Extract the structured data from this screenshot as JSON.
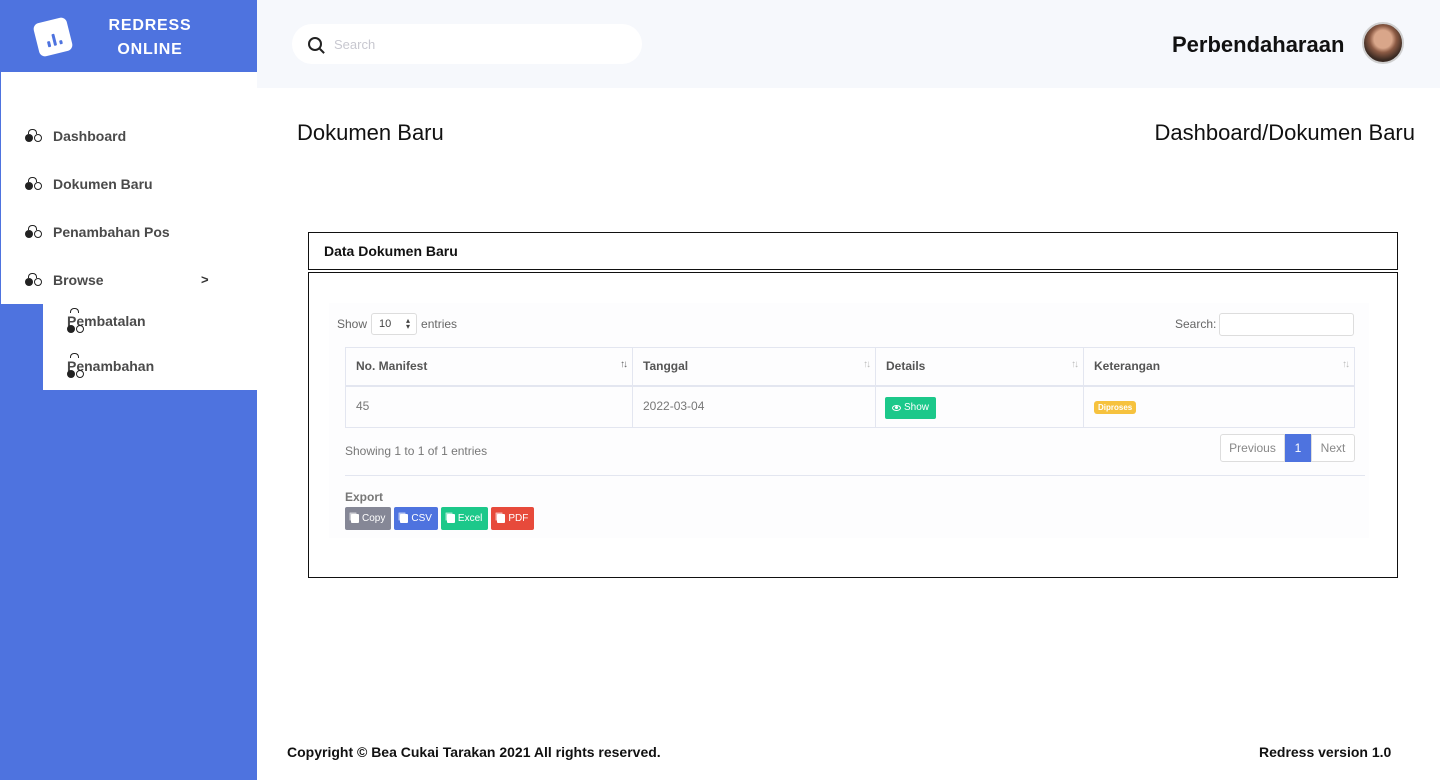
{
  "brand": {
    "line1": "REDRESS",
    "line2": "ONLINE"
  },
  "search": {
    "placeholder": "Search"
  },
  "user": {
    "name": "Perbendaharaan"
  },
  "sidebar": {
    "items": [
      {
        "label": "Dashboard"
      },
      {
        "label": "Dokumen Baru"
      },
      {
        "label": "Penambahan Pos"
      },
      {
        "label": "Browse",
        "chevron": ">"
      }
    ],
    "subitems": [
      {
        "label": "Pembatalan"
      },
      {
        "label": "Penambahan"
      }
    ]
  },
  "page": {
    "title": "Dokumen Baru",
    "breadcrumb": "Dashboard/Dokumen Baru"
  },
  "card": {
    "header": "Data Dokumen Baru"
  },
  "table_controls": {
    "show_label": "Show",
    "entries_value": "10",
    "entries_label": "entries",
    "search_label": "Search:"
  },
  "table": {
    "columns": [
      "No. Manifest",
      "Tanggal",
      "Details",
      "Keterangan"
    ],
    "rows": [
      {
        "manifest": "45",
        "tanggal": "2022-03-04",
        "details_btn": "Show",
        "keterangan": "Diproses"
      }
    ]
  },
  "pagination": {
    "info": "Showing 1 to 1 of 1 entries",
    "previous": "Previous",
    "current": "1",
    "next": "Next"
  },
  "export": {
    "label": "Export",
    "buttons": [
      {
        "label": "Copy",
        "color": "#858796"
      },
      {
        "label": "CSV",
        "color": "#4e73df"
      },
      {
        "label": "Excel",
        "color": "#1cc88a"
      },
      {
        "label": "PDF",
        "color": "#e74a3b"
      }
    ]
  },
  "footer": {
    "copyright": "Copyright © Bea Cukai Tarakan 2021 All rights reserved.",
    "version": "Redress version 1.0"
  },
  "colors": {
    "primary": "#4e73df",
    "success": "#1cc88a",
    "warning": "#f6c23e",
    "danger": "#e74a3b",
    "secondary": "#858796"
  }
}
